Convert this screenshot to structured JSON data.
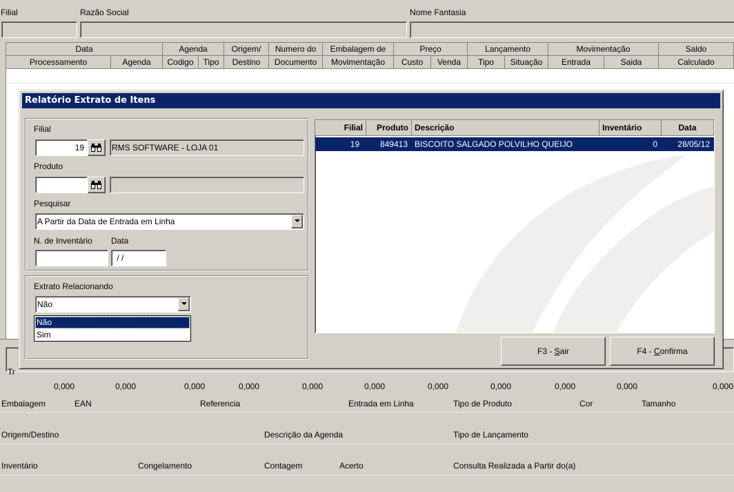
{
  "top": {
    "filial_label": "Filial",
    "razao_label": "Razão Social",
    "fantasia_label": "Nome Fantasia"
  },
  "grid": {
    "group_headers": [
      "Data",
      "Agenda",
      "Origem/",
      "Numero do",
      "Embalagem de",
      "Preço",
      "Lançamento",
      "Movimentação",
      "Saldo"
    ],
    "sub_headers": [
      "Processamento",
      "Agenda",
      "Codigo",
      "Tipo",
      "Destino",
      "Documento",
      "Movimentação",
      "Custo",
      "Venda",
      "Tipo",
      "Situação",
      "Entrada",
      "Saida",
      "Calculado"
    ]
  },
  "totals": {
    "label_fragment": "Tr",
    "values": [
      "0,000",
      "0,000",
      "0,000",
      "0,000",
      "0,000",
      "0,000",
      "0,000",
      "0,000",
      "0,000",
      "0,000"
    ]
  },
  "bottom": {
    "row1": [
      "Embalagem",
      "EAN",
      "Referencia",
      "Entrada em Linha",
      "Tipo de Produto",
      "Cor",
      "Tamanho"
    ],
    "row2": [
      "Origem/Destino",
      "Descrição da Agenda",
      "Tipo de Lançamento"
    ],
    "row3": [
      "Inventário",
      "Congelamento",
      "Contagem",
      "Acerto",
      "Consulta Realizada a Partir do(a)"
    ]
  },
  "dialog": {
    "title": "Relatório Extrato de Itens",
    "filial_label": "Filial",
    "filial_value": "19",
    "filial_name": "RMS SOFTWARE - LOJA 01",
    "produto_label": "Produto",
    "produto_value": "",
    "produto_name": "",
    "pesquisar_label": "Pesquisar",
    "pesquisar_value": "A Partir da Data de Entrada em Linha",
    "inventario_label": "N. de Inventário",
    "data_label": "Data",
    "inventario_value": "",
    "data_value": " / /",
    "extrato_label": "Extrato Relacionando",
    "extrato_value": "Não",
    "extrato_options": [
      "Não",
      "Sim"
    ],
    "table": {
      "headers": [
        "Filial",
        "Produto",
        "Descrição",
        "Inventário",
        "Data"
      ],
      "rows": [
        {
          "filial": "19",
          "produto": "849413",
          "descricao": "BISCOITO SALGADO POLVILHO QUEIJO",
          "inventario": "0",
          "data": "28/05/12"
        }
      ]
    },
    "btn_sair": "F3 - Sair",
    "btn_sair_pre": "F3 - ",
    "btn_sair_key": "S",
    "btn_sair_post": "air",
    "btn_confirma_pre": "F4 - ",
    "btn_confirma_key": "C",
    "btn_confirma_post": "onfirma"
  },
  "icons": {
    "search": "binoculars-icon"
  }
}
